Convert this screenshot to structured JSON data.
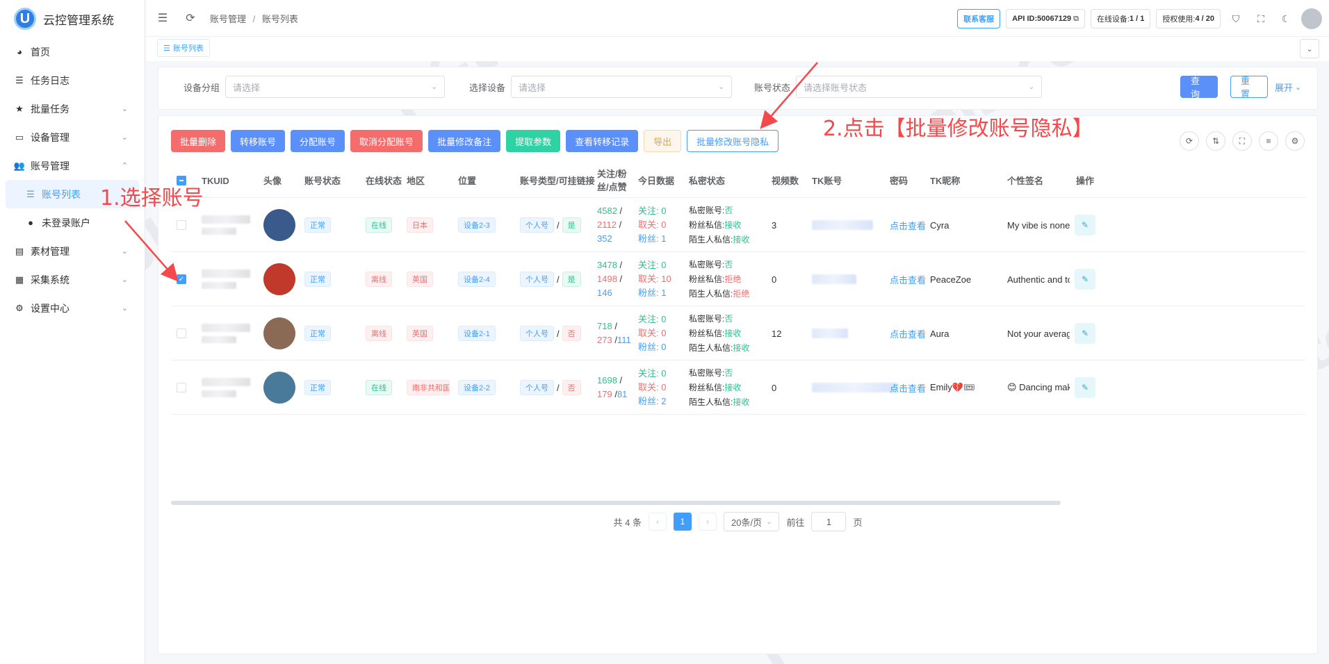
{
  "app": {
    "title": "云控管理系统"
  },
  "sidebar": {
    "items": [
      {
        "label": "首页",
        "icon": "dashboard-icon",
        "chevron": false
      },
      {
        "label": "任务日志",
        "icon": "list-icon",
        "chevron": false
      },
      {
        "label": "批量任务",
        "icon": "star-icon",
        "chevron": true
      },
      {
        "label": "设备管理",
        "icon": "monitor-icon",
        "chevron": true
      },
      {
        "label": "账号管理",
        "icon": "users-icon",
        "chevron": true
      },
      {
        "label": "账号列表",
        "icon": "list-icon",
        "active": true,
        "sub": true
      },
      {
        "label": "未登录账户",
        "icon": "user-icon",
        "sub": true
      },
      {
        "label": "素材管理",
        "icon": "folder-icon",
        "chevron": true
      },
      {
        "label": "采集系统",
        "icon": "database-icon",
        "chevron": true
      },
      {
        "label": "设置中心",
        "icon": "gear-icon",
        "chevron": true
      }
    ]
  },
  "breadcrumb": {
    "parent": "账号管理",
    "sep": "/",
    "current": "账号列表"
  },
  "topbar": {
    "support": "联系客服",
    "api_id": "API ID:50067129",
    "online_label": "在线设备: ",
    "online_value": "1 / 1",
    "license_label": "授权使用: ",
    "license_value": "4 / 20"
  },
  "tabs": {
    "active": "账号列表"
  },
  "search": {
    "group_label": "设备分组",
    "group_placeholder": "请选择",
    "device_label": "选择设备",
    "device_placeholder": "请选择",
    "status_label": "账号状态",
    "status_placeholder": "请选择账号状态",
    "query": "查询",
    "reset": "重置",
    "expand": "展开"
  },
  "toolbar": {
    "batch_delete": "批量删除",
    "transfer": "转移账号",
    "assign": "分配账号",
    "unassign": "取消分配账号",
    "batch_remark": "批量修改备注",
    "extract": "提取参数",
    "transfer_log": "查看转移记录",
    "export": "导出",
    "batch_privacy": "批量修改账号隐私"
  },
  "table": {
    "headers": [
      "TKUID",
      "头像",
      "账号状态",
      "在线状态",
      "地区",
      "位置",
      "账号类型/可挂链接",
      "关注/粉丝/点赞",
      "今日数据",
      "私密状态",
      "视频数",
      "TK账号",
      "密码",
      "TK昵称",
      "个性签名",
      "操作"
    ],
    "header_follow_1": "关注/粉",
    "header_follow_2": "丝/点赞",
    "rows": [
      {
        "checked": false,
        "status": "正常",
        "online": "在线",
        "online_type": "ok",
        "region": "日本",
        "device": "设备2-3",
        "acct_type": "个人号",
        "link": "是",
        "link_type": "ok",
        "follow": "4582",
        "fans": "2112",
        "likes": "352",
        "t_follow": "0",
        "t_unfollow": "0",
        "t_fans": "1",
        "private": "否",
        "fan_msg": "接收",
        "fan_msg_type": "g",
        "stranger_msg": "接收",
        "stranger_msg_type": "g",
        "videos": "3",
        "pwd": "点击查看",
        "nick": "Cyra",
        "sig": "My vibe is none ...",
        "avatar_color": "#3a5a8c"
      },
      {
        "checked": true,
        "status": "正常",
        "online": "离线",
        "online_type": "dang",
        "region": "英国",
        "device": "设备2-4",
        "acct_type": "个人号",
        "link": "是",
        "link_type": "ok",
        "follow": "3478",
        "fans": "1498",
        "likes": "146",
        "t_follow": "0",
        "t_unfollow": "10",
        "t_fans": "1",
        "private": "否",
        "fan_msg": "拒绝",
        "fan_msg_type": "r",
        "stranger_msg": "拒绝",
        "stranger_msg_type": "r",
        "videos": "0",
        "pwd": "点击查看",
        "nick": "PeaceZoe",
        "sig": "Authentic and to...",
        "avatar_color": "#c0392b"
      },
      {
        "checked": false,
        "status": "正常",
        "online": "离线",
        "online_type": "dang",
        "region": "英国",
        "device": "设备2-1",
        "acct_type": "个人号",
        "link": "否",
        "link_type": "dang",
        "follow": "718",
        "fans": "273",
        "likes": "111",
        "t_follow": "0",
        "t_unfollow": "0",
        "t_fans": "0",
        "private": "否",
        "fan_msg": "接收",
        "fan_msg_type": "g",
        "stranger_msg": "接收",
        "stranger_msg_type": "g",
        "videos": "12",
        "pwd": "点击查看",
        "nick": "Aura",
        "sig": "Not your average...",
        "avatar_color": "#8a6a55"
      },
      {
        "checked": false,
        "status": "正常",
        "online": "在线",
        "online_type": "ok",
        "region": "南非共和国",
        "device": "设备2-2",
        "acct_type": "个人号",
        "link": "否",
        "link_type": "dang",
        "follow": "1698",
        "fans": "179",
        "likes": "81",
        "t_follow": "0",
        "t_unfollow": "0",
        "t_fans": "2",
        "private": "否",
        "fan_msg": "接收",
        "fan_msg_type": "g",
        "stranger_msg": "接收",
        "stranger_msg_type": "g",
        "videos": "0",
        "pwd": "点击查看",
        "nick": "Emily💔🎟",
        "sig": "😊 Dancing mak...",
        "avatar_color": "#4a7a9a"
      }
    ],
    "labels": {
      "t_follow": "关注:",
      "t_unfollow": "取关:",
      "t_fans": "粉丝:",
      "private": "私密账号:",
      "fan_msg": "粉丝私信:",
      "stranger_msg": "陌生人私信:"
    }
  },
  "pagination": {
    "total": "共 4 条",
    "current": "1",
    "per_page": "20条/页",
    "goto": "前往",
    "page_value": "1",
    "page_suffix": "页"
  },
  "annotations": {
    "step1": "1.选择账号",
    "step2": "2.点击【批量修改账号隐私】"
  },
  "watermark": "TK-tools.cc",
  "colors": {
    "primary": "#409eff",
    "danger": "#f56c6c",
    "success": "#2fbf8f",
    "annotation": "#f5484a"
  }
}
